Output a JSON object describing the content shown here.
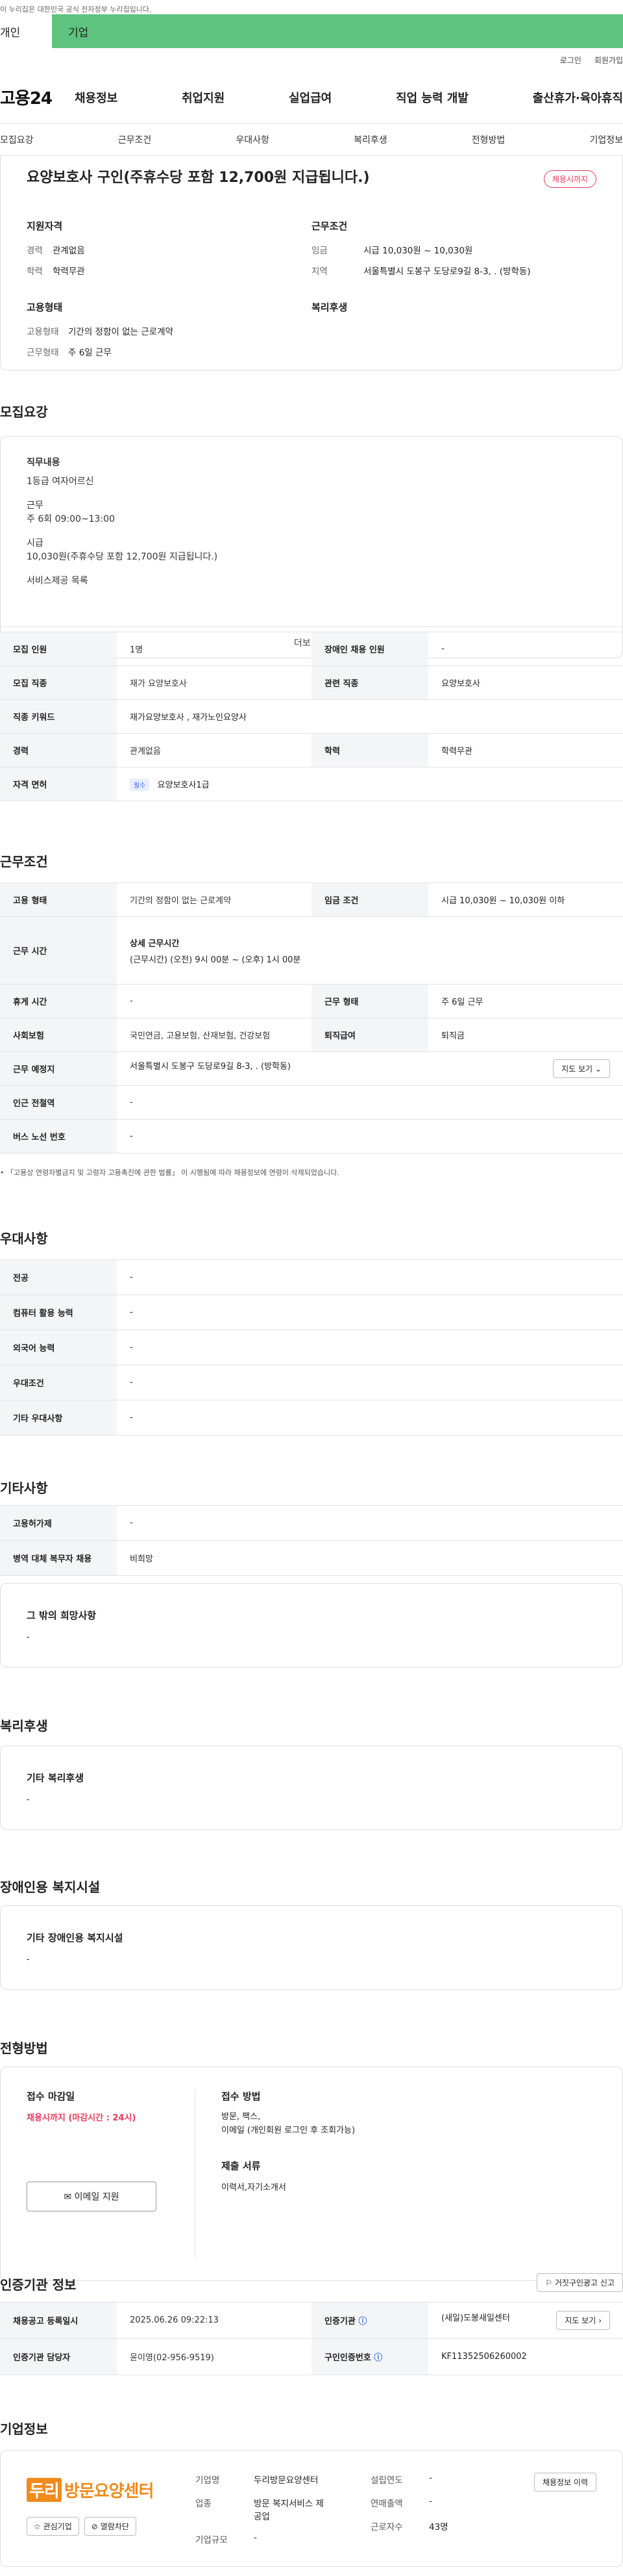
{
  "topbar": {
    "text": "이 누리집은 대한민국 공식 전자정부 누리집입니다."
  },
  "usertabs": {
    "tab1": "개인",
    "tab2": "기업"
  },
  "util": {
    "login": "로그인",
    "join": "회원가입"
  },
  "gnb": {
    "logo": "고용24",
    "menu": [
      "채용정보",
      "취업지원",
      "실업급여",
      "직업 능력 개발",
      "출산휴가·육아휴직"
    ]
  },
  "anchor": [
    "모집요강",
    "근무조건",
    "우대사항",
    "복리후생",
    "전형방법",
    "기업정보"
  ],
  "summary": {
    "title": "요양보호사 구인(주휴수당 포함 12,700원 지급됩니다.)",
    "badge": "채용시까지",
    "qual_title": "지원자격",
    "qual": [
      {
        "k": "경력",
        "v": "관계없음"
      },
      {
        "k": "학력",
        "v": "학력무관"
      }
    ],
    "cond_title": "근무조건",
    "cond": [
      {
        "k": "임금",
        "v": "시급 10,030원 ~ 10,030원"
      },
      {
        "k": "지역",
        "v": "서울특별시 도봉구 도당로9길 8-3, . (방학동)"
      }
    ],
    "emp_title": "고용형태",
    "emp": [
      {
        "k": "고용형태",
        "v": "기간의 정함이 없는 근로계약"
      },
      {
        "k": "근무형태",
        "v": "주 6일 근무"
      }
    ],
    "welfare_title": "복리후생"
  },
  "recruit": {
    "title": "모집요강",
    "lines": [
      "직무내용",
      "1등급 여자어르신",
      "",
      "근무",
      "주 6회   09:00~13:00",
      "",
      "시급",
      "10,030원(주휴수당 포함 12,700원 지급됩니다.)",
      "",
      "서비스제공 목록"
    ],
    "more": "더보기",
    "table": [
      [
        "모집 인원",
        "1명",
        "장애인 채용 인원",
        "-"
      ],
      [
        "모집 직종",
        "재가 요양보호사",
        "관련 직종",
        "요양보호사"
      ],
      [
        "직종 키워드",
        "재가요양보호사 , 재가노인요양사"
      ],
      [
        "경력",
        "관계없음",
        "학력",
        "학력무관"
      ],
      [
        "자격 면허",
        "요양보호사1급"
      ]
    ],
    "chip": "필수"
  },
  "work": {
    "title": "근무조건",
    "emp_type_h": "고용 형태",
    "emp_type_v": "기간의 정함이 없는 근로계약",
    "wage_h": "임금 조건",
    "wage_v": "시급 10,030원 ~ 10,030원 이하",
    "time_h": "근무 시간",
    "time_sub": "상세 근무시간",
    "time_v": "(근무시간) (오전) 9시 00분 ~ (오후) 1시 00분",
    "holiday_h": "휴게 시간",
    "holiday_v": "-",
    "worktype_h": "근무 형태",
    "worktype_v": "주 6일 근무",
    "ins_h": "사회보험",
    "ins_v": "국민연금, 고용보험, 산재보험, 건강보험",
    "ret_h": "퇴직급여",
    "ret_v": "퇴직금",
    "place_h": "근무 예정지",
    "place_v": "서울특별시 도봉구 도당로9길 8-3, . (방학동)",
    "map_btn": "지도 보기",
    "subway_h": "인근 전철역",
    "subway_v": "-",
    "bus_h": "버스 노선 번호",
    "bus_v": "-",
    "note": "「고용상 연령차별금지 및 고령자 고용촉진에 관한 법률」 이 시행됨에 따라 채용정보에 연령이 삭제되었습니다."
  },
  "pref": {
    "title": "우대사항",
    "rows": [
      [
        "전공",
        "-"
      ],
      [
        "컴퓨터 활용 능력",
        "-"
      ],
      [
        "외국어 능력",
        "-"
      ],
      [
        "우대조건",
        "-"
      ],
      [
        "기타 우대사항",
        "-"
      ]
    ]
  },
  "etc": {
    "title": "기타사항",
    "rows": [
      [
        "고용허가제",
        "-"
      ],
      [
        "병역 대체 복무자 채용",
        "비희망"
      ]
    ],
    "other_h": "그 밖의 희망사항",
    "other_v": "-"
  },
  "welfare": {
    "title": "복리후생",
    "sub": "기타 복리후생",
    "v": "-"
  },
  "disabled": {
    "title": "장애인용 복지시설",
    "sub": "기타 장애인용 복지시설",
    "v": "-"
  },
  "process": {
    "title": "전형방법",
    "deadline_h": "접수 마감일",
    "deadline_v": "채용시까지 (마감시간 : 24시)",
    "email_btn": "이메일 지원",
    "method_h": "접수 방법",
    "method_v1": "방문, 팩스,",
    "method_v2": "이메일 (개인회원 로그인 후 조회가능)",
    "docs_h": "제출 서류",
    "docs_v": "이력서,자기소개서"
  },
  "agency": {
    "title": "인증기관 정보",
    "report_btn": "거짓구인광고 신고",
    "rows": [
      [
        "채용공고 등록일시",
        "2025.06.26 09:22:13",
        "인증기관",
        "(새일)도봉새일센터"
      ],
      [
        "인증기관 담당자",
        "윤이영(02-956-9519)",
        "구인인증번호",
        "KF11352506260002"
      ]
    ],
    "map_btn": "지도 보기"
  },
  "company": {
    "title": "기업정보",
    "logo_accent": "두리",
    "logo_text": "방문요양센터",
    "fav_btn": "관심기업",
    "block_btn": "열람차단",
    "history_btn": "채용정보 이력",
    "rows": [
      {
        "k": "기업명",
        "v": "두리방문요양센터"
      },
      {
        "k": "업종",
        "v": "방문 복지서비스 제공업"
      },
      {
        "k": "기업규모",
        "v": "-"
      }
    ],
    "rows2": [
      {
        "k": "설립연도",
        "v": "-"
      },
      {
        "k": "연매출액",
        "v": "-"
      },
      {
        "k": "근로자수",
        "v": "43명"
      }
    ]
  }
}
